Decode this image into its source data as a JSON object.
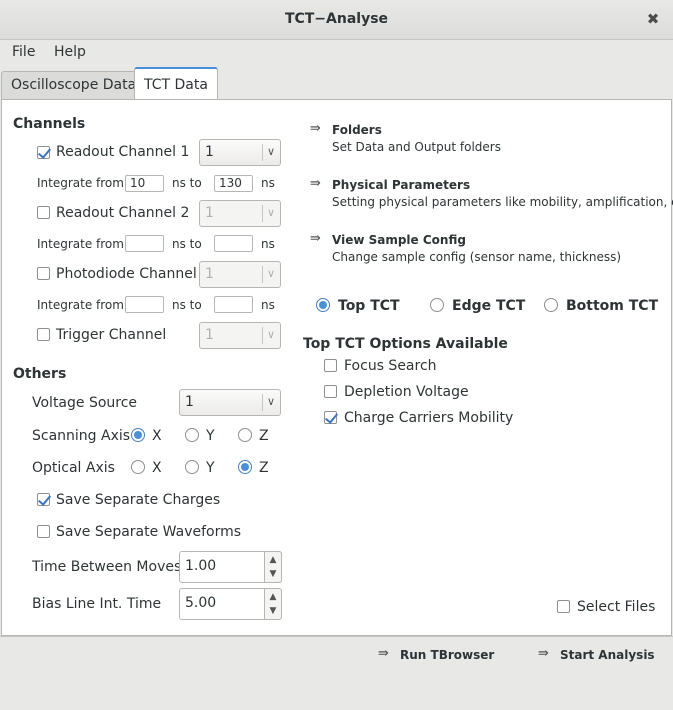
{
  "window": {
    "title": "TCT−Analyse",
    "close_glyph": "✖"
  },
  "menu": [
    "File",
    "Help"
  ],
  "tabs": [
    {
      "label": "Oscilloscope Data",
      "active": false
    },
    {
      "label": "TCT Data",
      "active": true
    }
  ],
  "channels": {
    "heading": "Channels",
    "items": [
      {
        "label": "Readout Channel 1",
        "checked": true,
        "combo_value": "1",
        "enabled": true,
        "integrate_label": "Integrate from",
        "from": "10",
        "mid_label": "ns to",
        "to": "130",
        "unit": "ns"
      },
      {
        "label": "Readout Channel 2",
        "checked": false,
        "combo_value": "1",
        "enabled": false,
        "integrate_label": "Integrate from",
        "from": "",
        "mid_label": "ns to",
        "to": "",
        "unit": "ns"
      },
      {
        "label": "Photodiode Channel",
        "checked": false,
        "combo_value": "1",
        "enabled": false,
        "integrate_label": "Integrate from",
        "from": "",
        "mid_label": "ns to",
        "to": "",
        "unit": "ns"
      },
      {
        "label": "Trigger Channel",
        "checked": false,
        "combo_value": "1",
        "enabled": false
      }
    ]
  },
  "others": {
    "heading": "Others",
    "voltage_source": {
      "label": "Voltage Source",
      "value": "1"
    },
    "scanning_axis": {
      "label": "Scanning Axis",
      "options": [
        "X",
        "Y",
        "Z"
      ],
      "selected": "X"
    },
    "optical_axis": {
      "label": "Optical Axis",
      "options": [
        "X",
        "Y",
        "Z"
      ],
      "selected": "Z"
    },
    "save_charges": {
      "label": "Save Separate Charges",
      "checked": true
    },
    "save_waveforms": {
      "label": "Save Separate Waveforms",
      "checked": false
    },
    "time_between_moves": {
      "label": "Time Between Moves",
      "value": "1.00"
    },
    "bias_line": {
      "label": "Bias Line Int. Time",
      "value": "5.00"
    }
  },
  "links": [
    {
      "title": "Folders",
      "description": "Set Data and Output folders"
    },
    {
      "title": "Physical Parameters",
      "description": "Setting physical parameters like mobility, amplification, etc"
    },
    {
      "title": "View Sample Config",
      "description": "Change sample config (sensor name, thickness)"
    }
  ],
  "tct_type": {
    "options": [
      "Top TCT",
      "Edge TCT",
      "Bottom TCT"
    ],
    "selected": "Top TCT"
  },
  "tct_options": {
    "heading": "Top TCT Options Available",
    "items": [
      {
        "label": "Focus Search",
        "checked": false
      },
      {
        "label": "Depletion Voltage",
        "checked": false
      },
      {
        "label": "Charge Carriers Mobility",
        "checked": true
      }
    ]
  },
  "select_files": {
    "label": "Select Files",
    "checked": false
  },
  "buttons": {
    "run_tbrowser": "Run TBrowser",
    "start_analysis": "Start Analysis"
  },
  "icons": {
    "link_arrow": "⇛",
    "chevron_down": "∨",
    "spin_up": "▲",
    "spin_down": "▼"
  },
  "colors": {
    "accent": "#4a90d9",
    "window_bg": "#e8e8e7",
    "panel_bg": "#ffffff"
  }
}
